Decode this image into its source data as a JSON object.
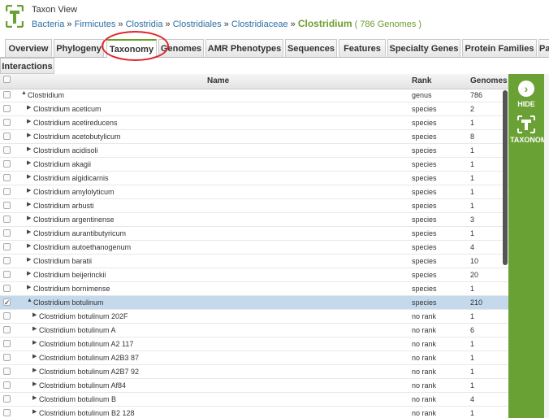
{
  "header": {
    "view_title": "Taxon View",
    "breadcrumb": [
      "Bacteria",
      "Firmicutes",
      "Clostridia",
      "Clostridiales",
      "Clostridiaceae"
    ],
    "separator": "»",
    "current": "Clostridium",
    "count": "( 786 Genomes )"
  },
  "tabs": [
    "Overview",
    "Phylogeny",
    "Taxonomy",
    "Genomes",
    "AMR Phenotypes",
    "Sequences",
    "Features",
    "Specialty Genes",
    "Protein Families",
    "Pa"
  ],
  "active_tab": "Taxonomy",
  "subtab": "Interactions",
  "grid": {
    "columns": {
      "name": "Name",
      "rank": "Rank",
      "genomes": "Genomes"
    },
    "rows": [
      {
        "name": "Clostridium",
        "rank": "genus",
        "genomes": "786",
        "level": 0,
        "expanded": true,
        "checked": false
      },
      {
        "name": "Clostridium aceticum",
        "rank": "species",
        "genomes": "2",
        "level": 1,
        "expanded": false,
        "checked": false
      },
      {
        "name": "Clostridium acetireducens",
        "rank": "species",
        "genomes": "1",
        "level": 1,
        "expanded": false,
        "checked": false
      },
      {
        "name": "Clostridium acetobutylicum",
        "rank": "species",
        "genomes": "8",
        "level": 1,
        "expanded": false,
        "checked": false
      },
      {
        "name": "Clostridium acidisoli",
        "rank": "species",
        "genomes": "1",
        "level": 1,
        "expanded": false,
        "checked": false
      },
      {
        "name": "Clostridium akagii",
        "rank": "species",
        "genomes": "1",
        "level": 1,
        "expanded": false,
        "checked": false
      },
      {
        "name": "Clostridium algidicarnis",
        "rank": "species",
        "genomes": "1",
        "level": 1,
        "expanded": false,
        "checked": false
      },
      {
        "name": "Clostridium amylolyticum",
        "rank": "species",
        "genomes": "1",
        "level": 1,
        "expanded": false,
        "checked": false
      },
      {
        "name": "Clostridium arbusti",
        "rank": "species",
        "genomes": "1",
        "level": 1,
        "expanded": false,
        "checked": false
      },
      {
        "name": "Clostridium argentinense",
        "rank": "species",
        "genomes": "3",
        "level": 1,
        "expanded": false,
        "checked": false
      },
      {
        "name": "Clostridium aurantibutyricum",
        "rank": "species",
        "genomes": "1",
        "level": 1,
        "expanded": false,
        "checked": false
      },
      {
        "name": "Clostridium autoethanogenum",
        "rank": "species",
        "genomes": "4",
        "level": 1,
        "expanded": false,
        "checked": false
      },
      {
        "name": "Clostridium baratii",
        "rank": "species",
        "genomes": "10",
        "level": 1,
        "expanded": false,
        "checked": false
      },
      {
        "name": "Clostridium beijerinckii",
        "rank": "species",
        "genomes": "20",
        "level": 1,
        "expanded": false,
        "checked": false
      },
      {
        "name": "Clostridium bornimense",
        "rank": "species",
        "genomes": "1",
        "level": 1,
        "expanded": false,
        "checked": false
      },
      {
        "name": "Clostridium botulinum",
        "rank": "species",
        "genomes": "210",
        "level": 1,
        "expanded": true,
        "checked": true
      },
      {
        "name": "Clostridium botulinum 202F",
        "rank": "no rank",
        "genomes": "1",
        "level": 2,
        "expanded": false,
        "checked": false
      },
      {
        "name": "Clostridium botulinum A",
        "rank": "no rank",
        "genomes": "6",
        "level": 2,
        "expanded": false,
        "checked": false
      },
      {
        "name": "Clostridium botulinum A2 117",
        "rank": "no rank",
        "genomes": "1",
        "level": 2,
        "expanded": false,
        "checked": false
      },
      {
        "name": "Clostridium botulinum A2B3 87",
        "rank": "no rank",
        "genomes": "1",
        "level": 2,
        "expanded": false,
        "checked": false
      },
      {
        "name": "Clostridium botulinum A2B7 92",
        "rank": "no rank",
        "genomes": "1",
        "level": 2,
        "expanded": false,
        "checked": false
      },
      {
        "name": "Clostridium botulinum Af84",
        "rank": "no rank",
        "genomes": "1",
        "level": 2,
        "expanded": false,
        "checked": false
      },
      {
        "name": "Clostridium botulinum B",
        "rank": "no rank",
        "genomes": "4",
        "level": 2,
        "expanded": false,
        "checked": false
      },
      {
        "name": "Clostridium botulinum B2 128",
        "rank": "no rank",
        "genomes": "1",
        "level": 2,
        "expanded": false,
        "checked": false
      }
    ]
  },
  "side_panel": {
    "hide_label": "HIDE",
    "taxonomy_label": "TAXONOMY",
    "color": "#6aa134"
  },
  "colors": {
    "accent": "#6a9e2e",
    "link": "#2a6ea6",
    "selected_row": "#c5d9ec",
    "annotation": "#e0262b"
  }
}
